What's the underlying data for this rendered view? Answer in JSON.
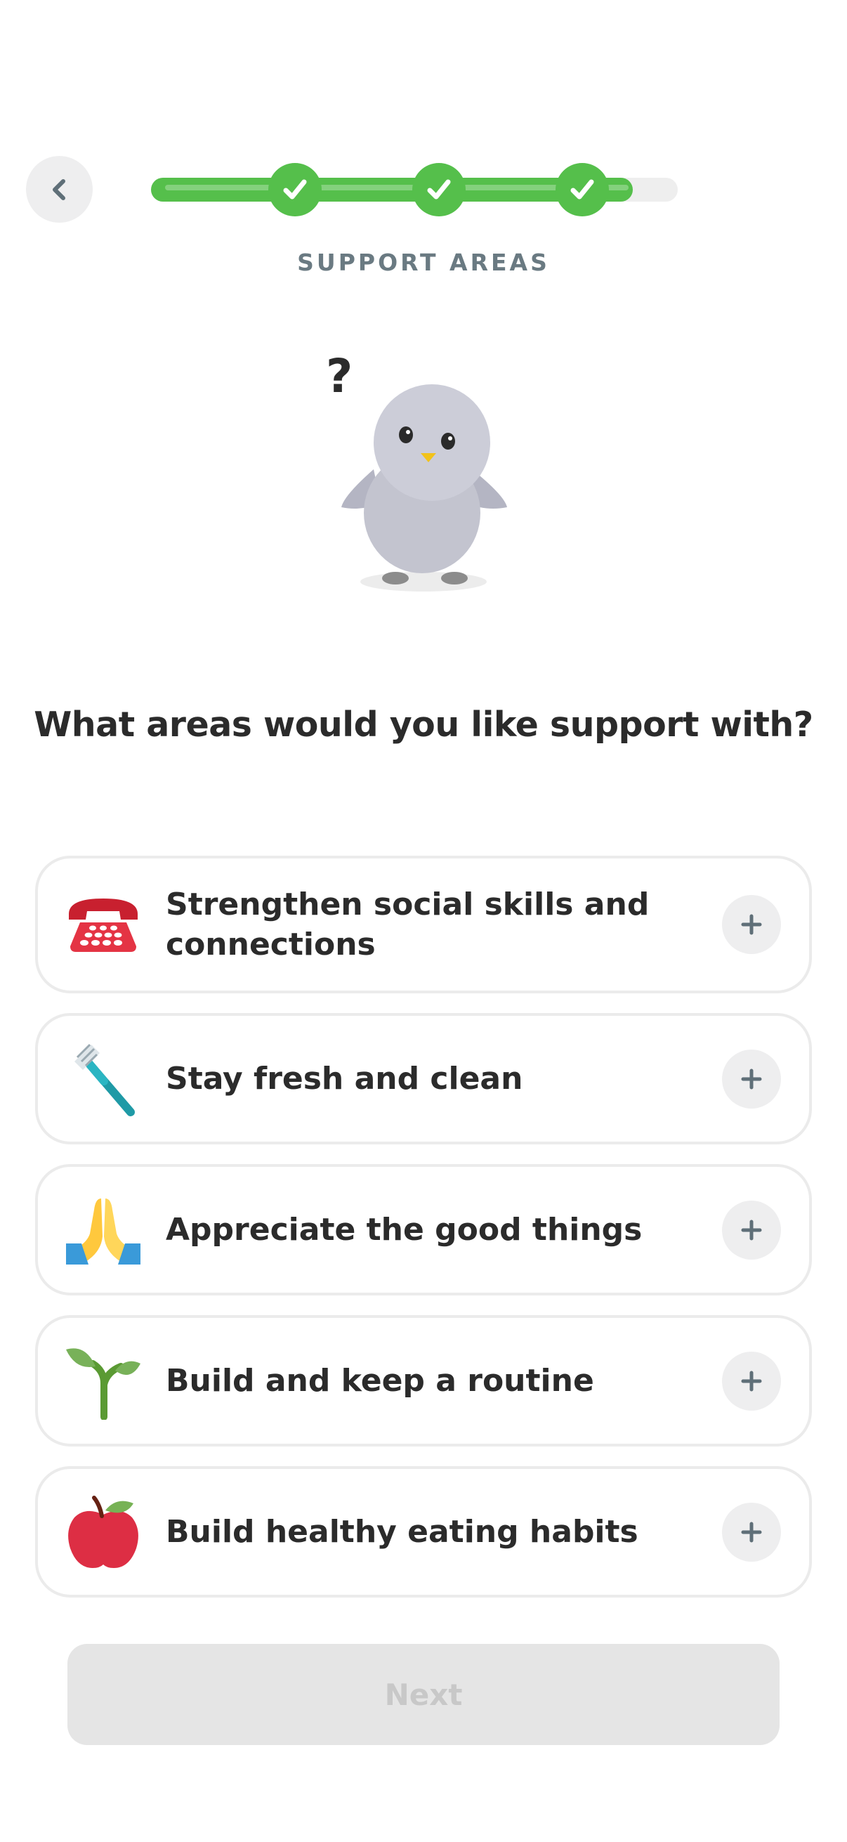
{
  "header": {
    "step_label": "SUPPORT AREAS",
    "progress": {
      "completed_steps": 3,
      "fill_fraction": 0.915
    }
  },
  "mascot": {
    "thought_mark": "?"
  },
  "question": "What areas would you like support with?",
  "options": [
    {
      "label": "Strengthen social skills and connections",
      "icon": "telephone-icon"
    },
    {
      "label": "Stay fresh and clean",
      "icon": "toothbrush-icon"
    },
    {
      "label": "Appreciate the good things",
      "icon": "praying-hands-icon"
    },
    {
      "label": "Build and keep a routine",
      "icon": "seedling-icon"
    },
    {
      "label": "Build healthy eating habits",
      "icon": "apple-icon"
    }
  ],
  "next_button": {
    "label": "Next",
    "enabled": false
  },
  "colors": {
    "progress_green": "#55bf4b",
    "track_gray": "#eeeeee",
    "label_gray": "#6a7a82"
  }
}
